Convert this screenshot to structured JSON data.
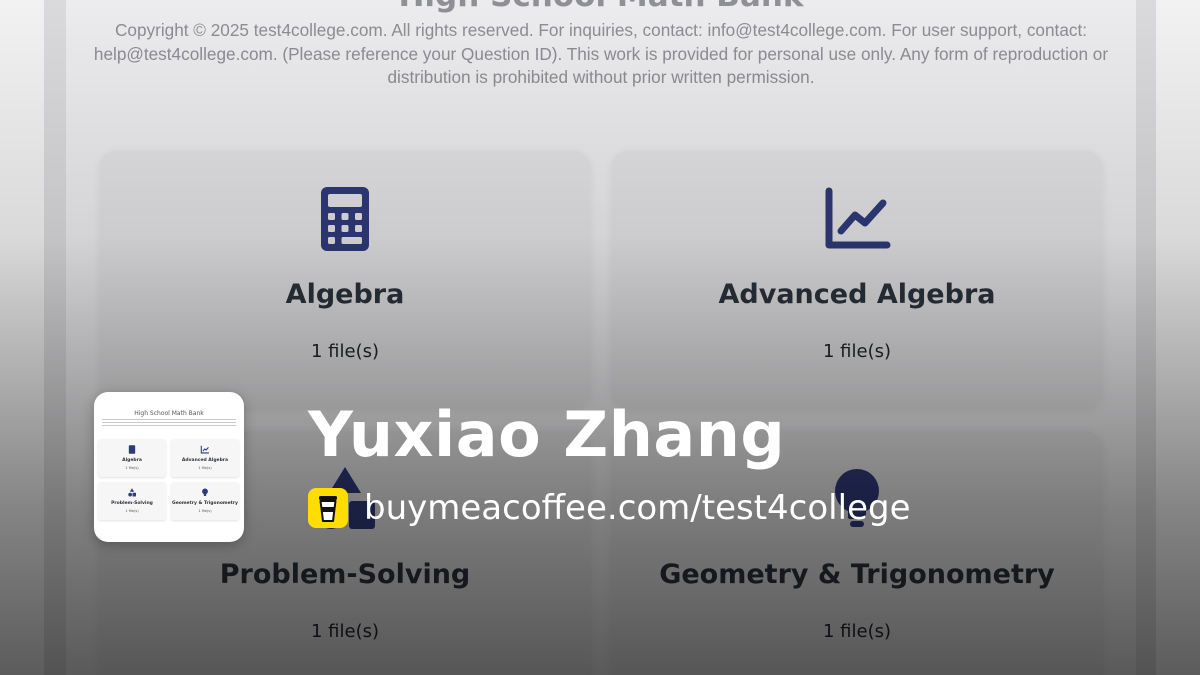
{
  "page": {
    "title": "High School Math Bank",
    "copyright": "Copyright © 2025 test4college.com. All rights reserved. For inquiries, contact: info@test4college.com. For user support, contact: help@test4college.com. (Please reference your Question ID). This work is provided for personal use only. Any form of reproduction or distribution is prohibited without prior written permission."
  },
  "categories": [
    {
      "title": "Algebra",
      "count": "1 file(s)",
      "icon": "calculator-icon"
    },
    {
      "title": "Advanced Algebra",
      "count": "1 file(s)",
      "icon": "line-chart-icon"
    },
    {
      "title": "Problem-Solving",
      "count": "1 file(s)",
      "icon": "shapes-icon"
    },
    {
      "title": "Geometry & Trigonometry",
      "count": "1 file(s)",
      "icon": "lightbulb-icon"
    }
  ],
  "overlay": {
    "author": "Yuxiao Zhang",
    "link": "buymeacoffee.com/test4college",
    "link_icon": "coffee-cup-icon"
  },
  "colors": {
    "icon": "#2f3a7a",
    "card_title": "#2c333d",
    "coffee_badge": "#ffdd00"
  }
}
